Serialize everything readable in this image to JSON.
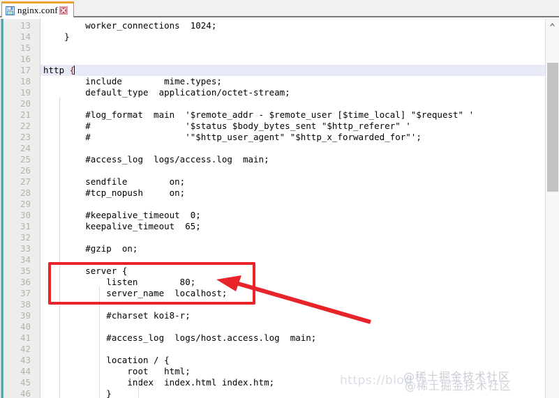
{
  "window": {
    "tab": {
      "label": "nginx.conf",
      "save_icon": "floppy-disk-icon",
      "close_icon": "close-x-icon",
      "accent_color": "#f0a030"
    }
  },
  "editor": {
    "first_line_number": 13,
    "line_height": 16,
    "highlighted_line": 17,
    "caret_line": 17,
    "gutter_color": "#eeedeb",
    "line_number_color": "#b4b2ae",
    "highlight_color": "#e8eaf8",
    "bracket_color": "#d00000",
    "lines": [
      {
        "n": "13",
        "text": "        worker_connections  1024;"
      },
      {
        "n": "14",
        "text": "    }"
      },
      {
        "n": "15",
        "text": ""
      },
      {
        "n": "16",
        "text": ""
      },
      {
        "n": "17",
        "text": "http {"
      },
      {
        "n": "18",
        "text": "        include        mime.types;"
      },
      {
        "n": "19",
        "text": "        default_type  application/octet-stream;"
      },
      {
        "n": "20",
        "text": ""
      },
      {
        "n": "21",
        "text": "        #log_format  main  '$remote_addr - $remote_user [$time_local] \"$request\" '"
      },
      {
        "n": "22",
        "text": "        #                  '$status $body_bytes_sent \"$http_referer\" '"
      },
      {
        "n": "23",
        "text": "        #                  '\"$http_user_agent\" \"$http_x_forwarded_for\"';"
      },
      {
        "n": "24",
        "text": ""
      },
      {
        "n": "25",
        "text": "        #access_log  logs/access.log  main;"
      },
      {
        "n": "26",
        "text": ""
      },
      {
        "n": "27",
        "text": "        sendfile        on;"
      },
      {
        "n": "28",
        "text": "        #tcp_nopush     on;"
      },
      {
        "n": "29",
        "text": ""
      },
      {
        "n": "30",
        "text": "        #keepalive_timeout  0;"
      },
      {
        "n": "31",
        "text": "        keepalive_timeout  65;"
      },
      {
        "n": "32",
        "text": ""
      },
      {
        "n": "33",
        "text": "        #gzip  on;"
      },
      {
        "n": "34",
        "text": ""
      },
      {
        "n": "35",
        "text": "        server {"
      },
      {
        "n": "36",
        "text": "            listen        80;"
      },
      {
        "n": "37",
        "text": "            server_name  localhost;"
      },
      {
        "n": "38",
        "text": ""
      },
      {
        "n": "39",
        "text": "            #charset koi8-r;"
      },
      {
        "n": "40",
        "text": ""
      },
      {
        "n": "41",
        "text": "            #access_log  logs/host.access.log  main;"
      },
      {
        "n": "42",
        "text": ""
      },
      {
        "n": "43",
        "text": "            location / {"
      },
      {
        "n": "44",
        "text": "                root   html;"
      },
      {
        "n": "45",
        "text": "                index  index.html index.htm;"
      },
      {
        "n": "46",
        "text": "            }"
      }
    ]
  },
  "scrollbar": {
    "up_arrow_icon": "chevron-up-icon",
    "thumb_color": "#c2c2c2",
    "track_color": "#f7f7f7"
  },
  "annotations": {
    "highlight_box": {
      "color": "#e8232a",
      "covers_lines": "35-37"
    },
    "arrow": {
      "color": "#e8232a",
      "points_to": "server block"
    }
  },
  "watermark": {
    "url_text": "https://blog",
    "community_text_1": "@稀土掘金技术社区",
    "community_text_2": "@稀土掘金技术社区"
  }
}
